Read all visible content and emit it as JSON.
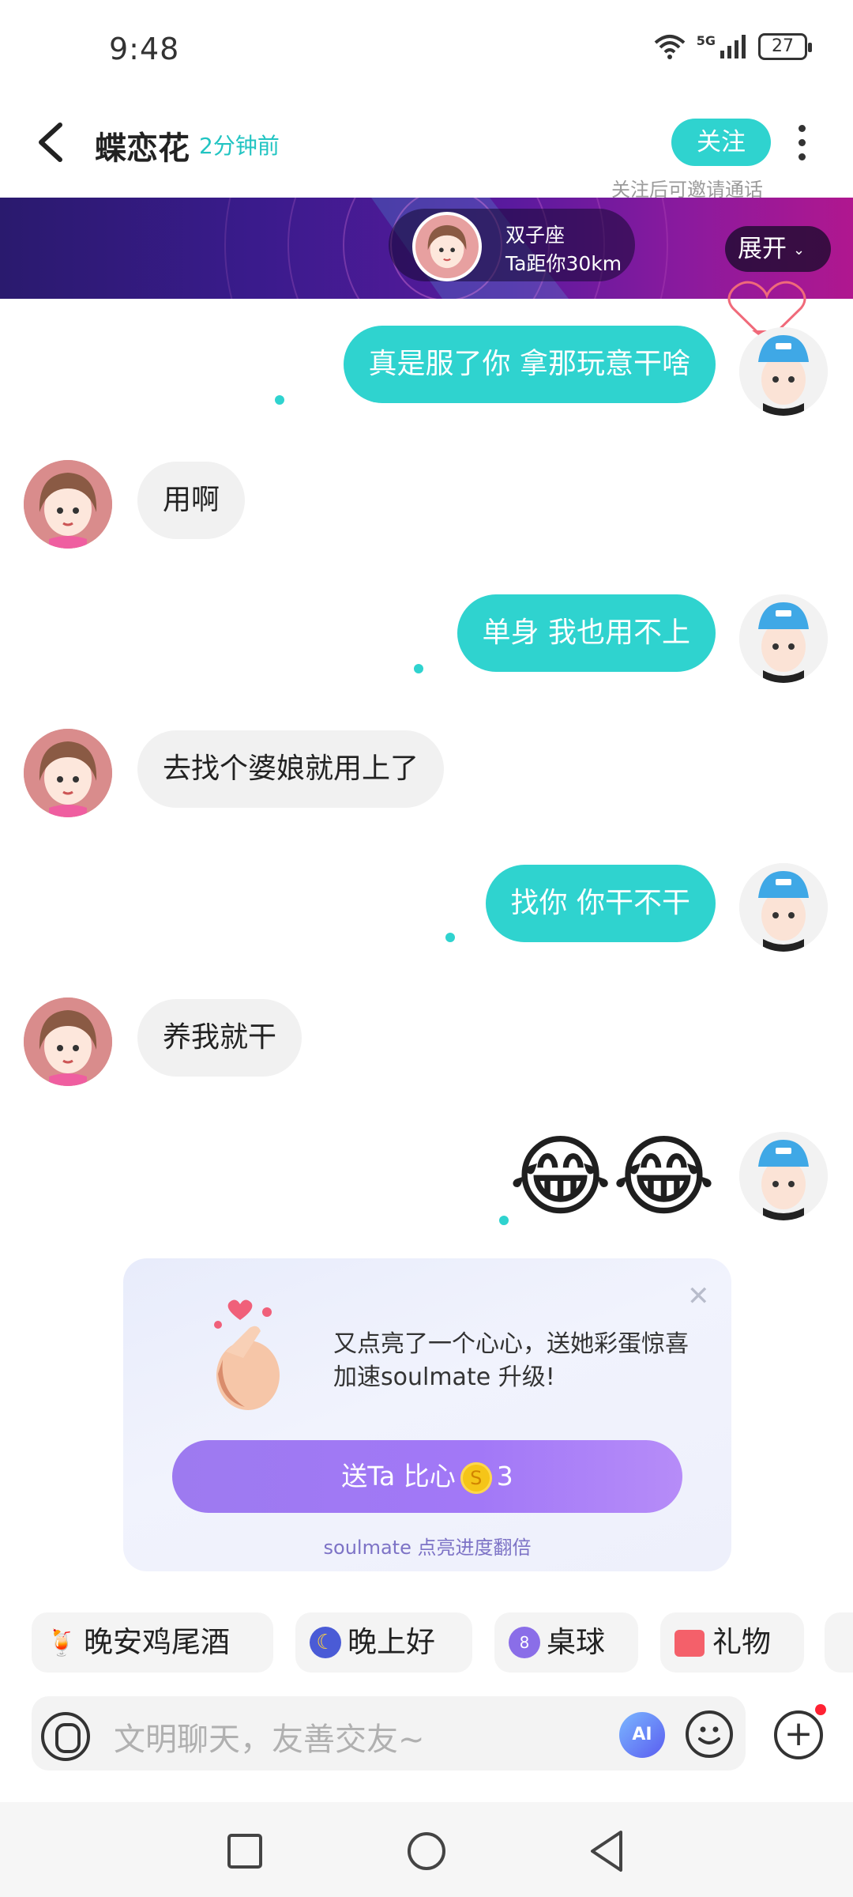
{
  "status_bar": {
    "time": "9:48",
    "network": "5G",
    "battery": "27"
  },
  "header": {
    "title": "蝶恋花",
    "last_seen": "2分钟前",
    "follow_label": "关注",
    "follow_hint": "关注后可邀请通话"
  },
  "banner": {
    "zodiac": "双子座",
    "distance": "Ta距你30km",
    "expand_label": "展开"
  },
  "messages": [
    {
      "side": "right",
      "text": "真是服了你  拿那玩意干啥"
    },
    {
      "side": "left",
      "text": "用啊"
    },
    {
      "side": "right",
      "text": "单身  我也用不上"
    },
    {
      "side": "left",
      "text": "去找个婆娘就用上了"
    },
    {
      "side": "right",
      "text": "找你  你干不干"
    },
    {
      "side": "left",
      "text": "养我就干"
    },
    {
      "side": "right",
      "text": "😂😂"
    }
  ],
  "gift_card": {
    "text": "又点亮了一个心心，送她彩蛋惊喜加速soulmate 升级!",
    "button_prefix": "送Ta 比心",
    "coin_symbol": "S",
    "cost": "3",
    "subtext": "soulmate 点亮进度翻倍"
  },
  "quick_replies": [
    {
      "label": "晚安鸡尾酒",
      "icon": "cocktail-icon"
    },
    {
      "label": "晚上好",
      "icon": "moon-icon"
    },
    {
      "label": "桌球",
      "icon": "billiard-ball-icon"
    },
    {
      "label": "礼物",
      "icon": "gift-icon"
    }
  ],
  "input": {
    "placeholder": "文明聊天，友善交友~",
    "ai_label": "AI"
  },
  "colors": {
    "accent": "#2fd3cf",
    "button_purple": "#a278f7",
    "banner": "#5a1a9e"
  }
}
